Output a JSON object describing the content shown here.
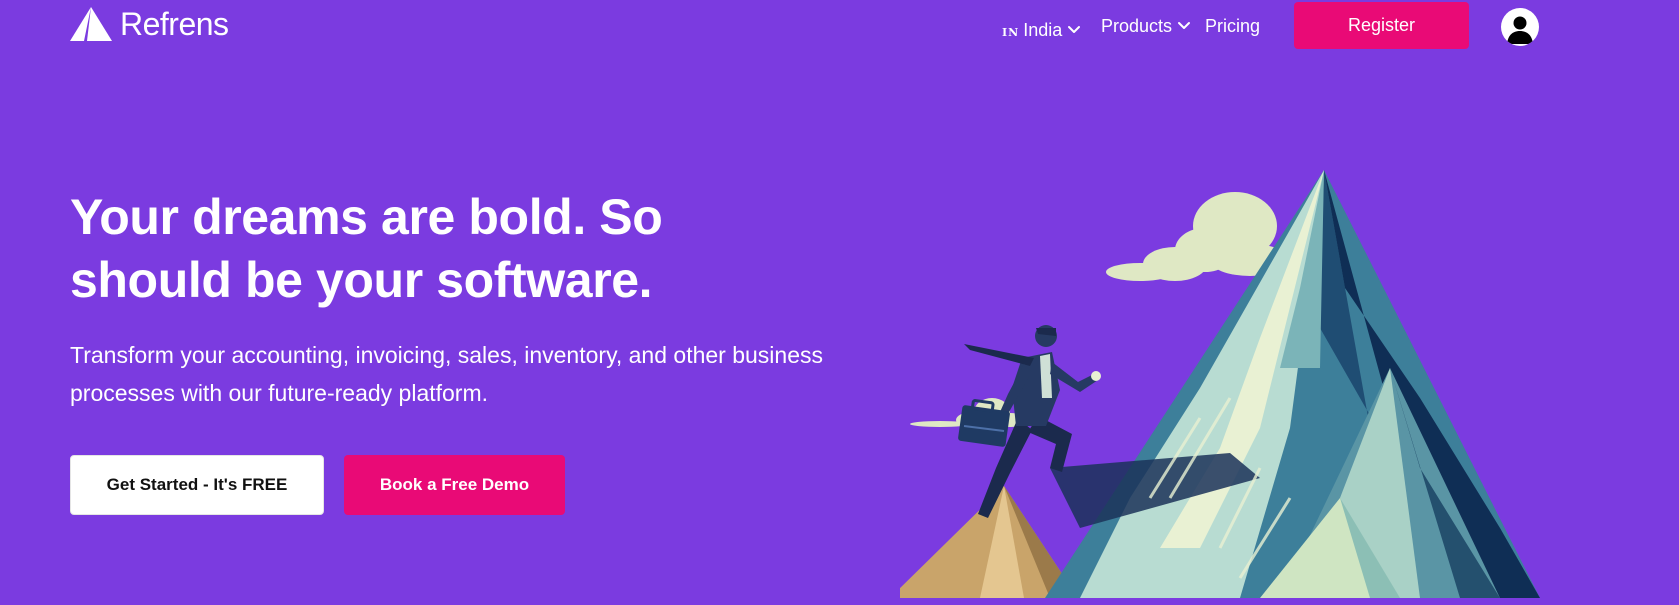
{
  "header": {
    "brand_name": "Refrens",
    "country": {
      "code": "IN",
      "label": "India"
    },
    "nav": {
      "products_label": "Products",
      "pricing_label": "Pricing"
    },
    "register_label": "Register"
  },
  "hero": {
    "title": "Your dreams are bold. So should be your software.",
    "subtitle": "Transform your accounting, invoicing, sales, inventory, and other business processes with our future-ready platform.",
    "primary_cta": "Get Started - It's FREE",
    "secondary_cta": "Book a Free Demo"
  },
  "colors": {
    "background": "#7b3be0",
    "accent": "#e90a76",
    "primary_cta_bg": "#ffffff"
  },
  "icons": {
    "logo": "triangle-logo-icon",
    "dropdown": "chevron-down-icon",
    "avatar": "user-avatar-icon"
  }
}
